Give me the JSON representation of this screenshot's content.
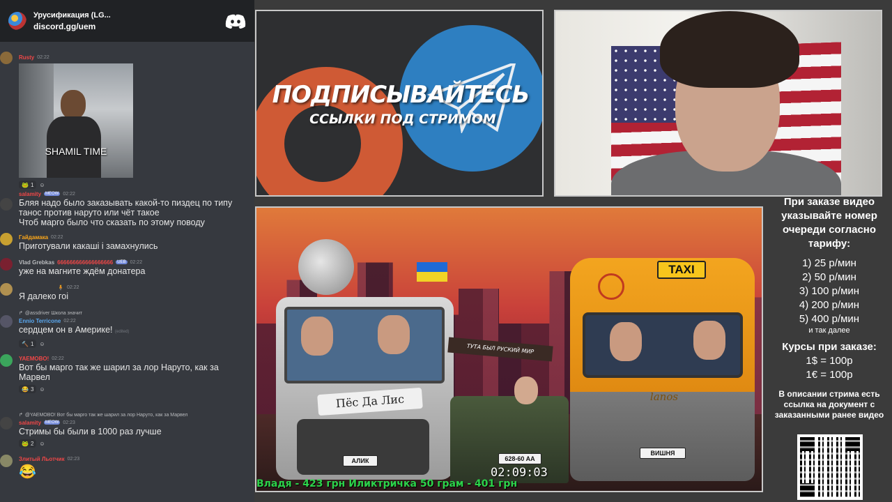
{
  "chat": {
    "server_name": "Урусификация (LG...",
    "server_link": "discord.gg/uem",
    "messages": [
      {
        "user": "Rusty",
        "time": "02:22",
        "user_color": "#f04747",
        "image_caption": "SHAMIL TIME",
        "reactions": [
          {
            "emoji": "🐸",
            "count": "1"
          }
        ]
      },
      {
        "user": "salamity",
        "badge": "MEOW",
        "time": "02:22",
        "user_color": "#f04747",
        "text": "Бляя надо было заказывать какой-то пиздец по типу танос против наруто или чёт такое",
        "text2": "Чтоб марго было что сказать по этому поводу"
      },
      {
        "user": "Гайдамака",
        "time": "02:22",
        "user_color": "#faa61a",
        "text": "Приготували какаші і замахнулись"
      },
      {
        "user": "Vlad Grebkas",
        "user_suffix": "666666666666666666",
        "badge": "UEB",
        "time": "02:22",
        "user_color": "#b9bbbe",
        "text": "уже на магните ждём донатера"
      },
      {
        "time": "02:22",
        "text": "Я далеко гоі"
      },
      {
        "reply": "@assdriver Школа значит",
        "user": "Ennio Terricone",
        "time": "02:22",
        "user_color": "#5aa8f0",
        "text": "сердцем он в Америке!",
        "edited": "(edited)",
        "reactions": [
          {
            "emoji": "🔨",
            "count": "1"
          }
        ]
      },
      {
        "user": "YAEMOBO!",
        "time": "02:22",
        "user_color": "#f04747",
        "text": "Вот бы марго так же шарил за лор Наруто, как за Марвел",
        "reactions": [
          {
            "emoji": "😂",
            "count": "3"
          }
        ]
      },
      {
        "reply": "@YAEMOBO! Вот бы марго так же шарил за лор Наруто, как за Марвел",
        "user": "salamity",
        "badge": "MEOW",
        "time": "02:23",
        "user_color": "#f04747",
        "text": "Стримы бы были в 1000 раз лучше",
        "reactions": [
          {
            "emoji": "🐸",
            "count": "2"
          }
        ]
      },
      {
        "user": "Злитый Льотчик",
        "time": "02:23",
        "user_color": "#f04747",
        "emoji_only": "😂"
      }
    ]
  },
  "promo": {
    "title": "ПОДПИСЫВАЙТЕСЬ",
    "subtitle": "ССЫЛКИ ПОД СТРИМОМ"
  },
  "game": {
    "decal_text": "Пёс Да Лис",
    "sign_text": "ТУТА БЫЛ РУСКИЙ МИР",
    "taxi_sign": "TAXI",
    "van_script": "lanos",
    "plate_left": "АЛИК",
    "plate_right": "ВИШНЯ",
    "plate_tank": "628-60 AA",
    "timer": "02:09:03",
    "ticker": "Владя - 423 грн    Иликтричка 50 грам - 401 грн"
  },
  "info": {
    "header": "При заказе видео указывайте номер очереди согласно тарифу:",
    "tariffs": [
      "1) 25 р/мин",
      "2) 50 р/мин",
      "3) 100 р/мин",
      "4) 200 р/мин",
      "5) 400 р/мин"
    ],
    "tariff_note": "и так далее",
    "rates_header": "Курсы при заказе:",
    "rates": [
      "1$ = 100р",
      "1€ = 100р"
    ],
    "description": "В описании стрима есть ссылка на документ с заказанными ранее видео"
  }
}
